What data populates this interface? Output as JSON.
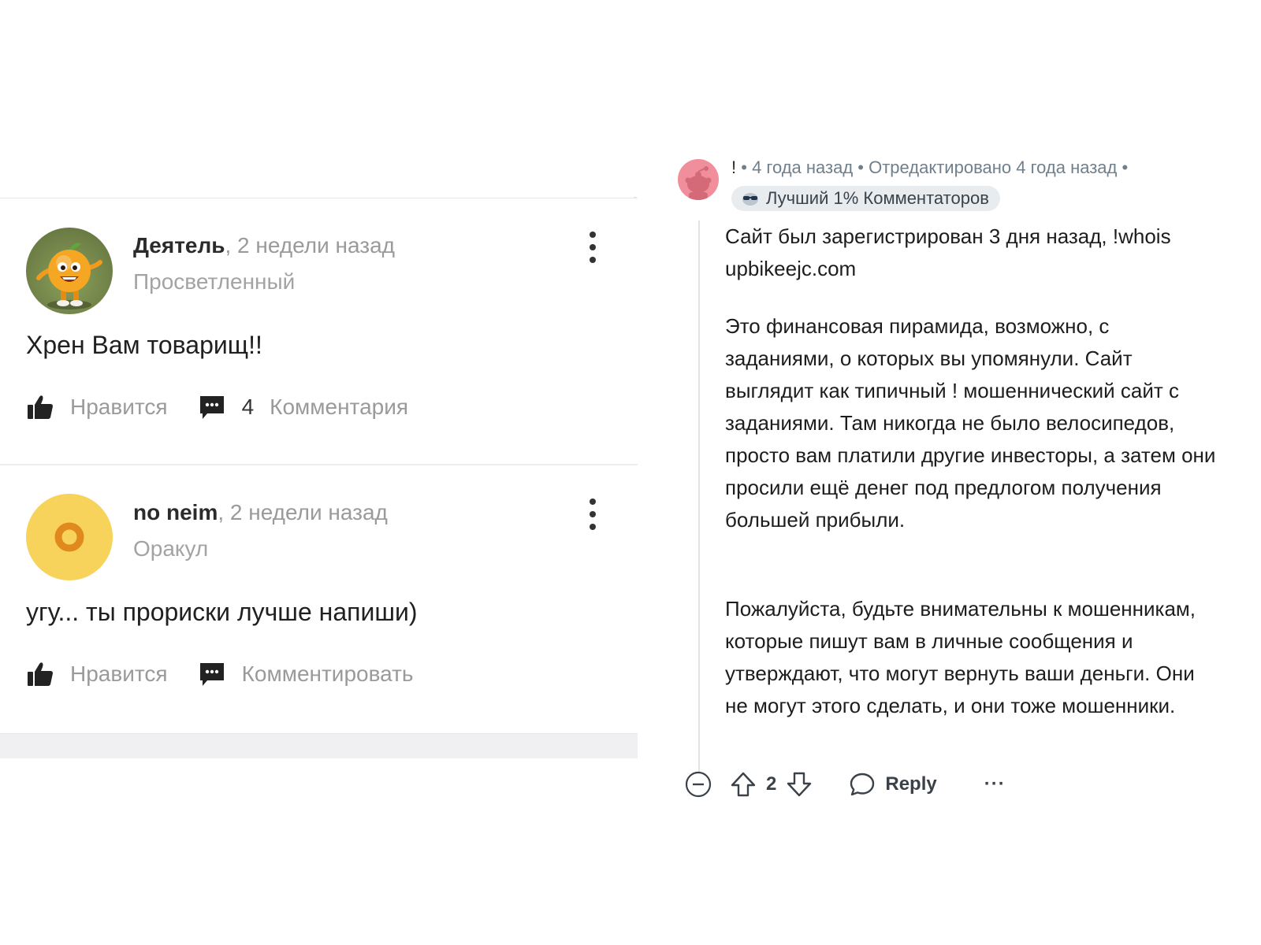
{
  "left_panel": {
    "comments": [
      {
        "author": "Деятель",
        "time": ", 2 недели назад",
        "rank": "Просветленный",
        "text": "Хрен Вам товарищ!!",
        "like_label": "Нравится",
        "comment_count": "4",
        "comment_label": "Комментария"
      },
      {
        "author": "no neim",
        "time": ", 2 недели назад",
        "rank": "Оракул",
        "text": "угу... ты прориски лучше напиши)",
        "like_label": "Нравится",
        "comment_label": "Комментировать"
      }
    ]
  },
  "right_panel": {
    "username": "!",
    "meta": "• 4 года назад • Отредактировано 4 года назад •",
    "flair": "Лучший 1% Комментаторов",
    "paragraphs": [
      "Сайт был зарегистрирован 3 дня назад, !whois upbikeejc.com",
      "Это финансовая пирамида, возможно, с заданиями, о которых вы упомянули. Сайт выглядит как типичный ! мошеннический сайт с заданиями. Там никогда не было велосипедов, просто вам платили другие инвесторы, а затем они просили ещё денег под предлогом получения большей прибыли.",
      "Пожалуйста, будьте внимательны к мошенникам, которые пишут вам в личные сообщения и утверждают, что могут вернуть ваши деньги. Они не могут этого сделать, и они тоже мошенники."
    ],
    "vote_count": "2",
    "reply_label": "Reply",
    "more_label": "···"
  },
  "colors": {
    "accent_avatar_yellow": "#f7d35c",
    "right_avatar_pink": "#f08f9b",
    "muted_text": "#9a9a9a",
    "meta_text": "#6f7f8c",
    "flair_bg": "#e9ecef"
  },
  "icons": {
    "like": "thumbs-up-icon",
    "comment": "comment-bubble-icon",
    "menu": "kebab-menu-icon",
    "collapse": "collapse-minus-icon",
    "upvote": "upvote-arrow-icon",
    "downvote": "downvote-arrow-icon",
    "reply": "reply-bubble-icon",
    "flair": "sunglasses-snoo-icon"
  }
}
